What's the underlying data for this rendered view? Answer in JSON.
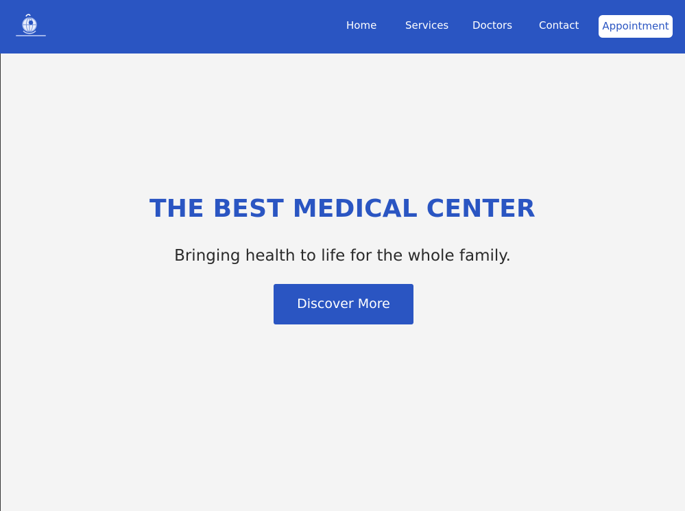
{
  "colors": {
    "primary": "#2a55c2",
    "background": "#f4f4f4",
    "nav_text": "#ffffff",
    "subtitle_text": "#2b2b2b"
  },
  "header": {
    "logo_icon": "medical-globe-logo-icon",
    "nav": {
      "home": "Home",
      "services": "Services",
      "doctors": "Doctors",
      "contact": "Contact"
    },
    "appointment_label": "Appointment"
  },
  "hero": {
    "title": "THE BEST MEDICAL CENTER",
    "subtitle": "Bringing health to life for the whole family.",
    "cta_label": "Discover More"
  }
}
